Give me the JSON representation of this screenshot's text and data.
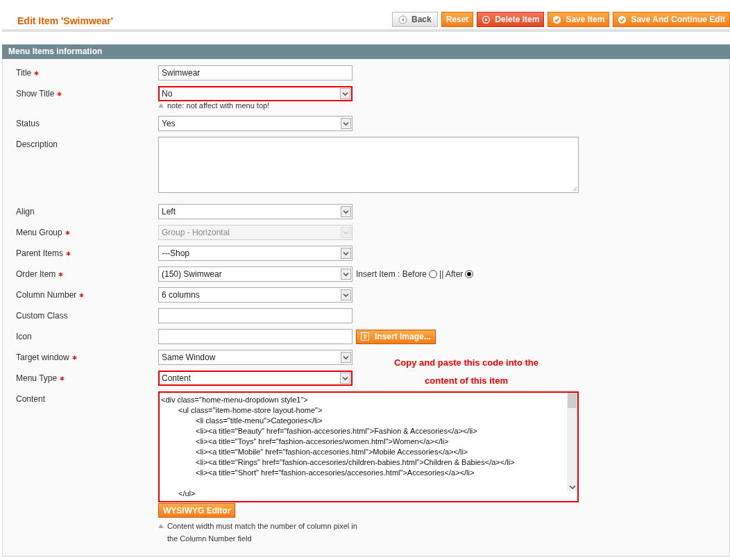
{
  "header": {
    "title": "Edit Item 'Swimwear'",
    "buttons": [
      {
        "label": "Back",
        "kind": "back"
      },
      {
        "label": "Reset",
        "kind": "plain"
      },
      {
        "label": "Delete Item",
        "kind": "delete"
      },
      {
        "label": "Save Item",
        "kind": "save"
      },
      {
        "label": "Save And Continue Edit",
        "kind": "save"
      }
    ]
  },
  "section": {
    "title": "Menu Items information",
    "fields": [
      {
        "label": "Title",
        "required": true,
        "kind": "text",
        "value": "Swimwear",
        "disabled": false,
        "highlighted": false
      },
      {
        "label": "Show Title",
        "required": true,
        "kind": "select",
        "value": "No",
        "disabled": false,
        "highlighted": true,
        "note": "note: not affect with menu top!"
      },
      {
        "label": "Status",
        "required": false,
        "kind": "select",
        "value": "Yes",
        "disabled": false,
        "highlighted": false
      },
      {
        "label": "Description",
        "required": false,
        "kind": "textarea",
        "disabled": false,
        "highlighted": false
      },
      {
        "label": "Align",
        "required": false,
        "kind": "select",
        "value": "Left",
        "disabled": false,
        "highlighted": false
      },
      {
        "label": "Menu Group",
        "required": true,
        "kind": "select",
        "value": "Group - Horizontal",
        "disabled": true,
        "highlighted": false
      },
      {
        "label": "Parent Items",
        "required": true,
        "kind": "select",
        "value": "---Shop",
        "disabled": false,
        "highlighted": false
      },
      {
        "label": "Order Item",
        "required": true,
        "kind": "select",
        "value": "(150) Swimwear",
        "disabled": false,
        "highlighted": false,
        "radios": [
          {
            "label": "Insert Item : Before",
            "selected": false
          },
          {
            "label": "|| After",
            "selected": true
          }
        ]
      },
      {
        "label": "Column Number",
        "required": true,
        "kind": "select",
        "value": "6 columns",
        "disabled": false,
        "highlighted": false
      },
      {
        "label": "Custom Class",
        "required": false,
        "kind": "text",
        "disabled": false,
        "highlighted": false
      },
      {
        "label": "Icon",
        "required": false,
        "kind": "text",
        "disabled": false,
        "highlighted": false,
        "button": "Insert Image..."
      },
      {
        "label": "Target window",
        "required": true,
        "kind": "select",
        "value": "Same Window",
        "disabled": false,
        "highlighted": false
      },
      {
        "label": "Menu Type",
        "required": true,
        "kind": "select",
        "value": "Content",
        "disabled": false,
        "highlighted": true,
        "annotation": "Copy and paste this code into the content of this item"
      },
      {
        "label": "Content",
        "required": false,
        "kind": "code",
        "disabled": false,
        "highlighted": true,
        "value": "<div class=\"home-menu-dropdown style1\">\n\t<ul class=\"item-home-store layout-home\">\n\t\t<li class=\"title-menu\">Categories</li>\n\t\t<li><a title=\"Beauty\" href=\"fashion-accesories.html\">Fashion & Accesories</a></li>\n\t\t<li><a title=\"Toys\" href=\"fashion-accesories/women.html\">Women</a></li>\n\t\t<li><a title=\"Mobile\" href=\"fashion-accesories.html\">Mobile Accessories</a></li>\n\t\t<li><a title=\"Rings\" href=\"fashion-accesories/children-babies.html\">Children & Babies</a></li>\n\t\t<li><a title=\"Short\" href=\"fashion-accesories/accesories.html\">Accesories</a></li>\n\n\t</ul>",
        "button": "WYSIWYG Editor",
        "note": "Content width must match the number of column pixel in the Column Number field"
      }
    ]
  }
}
